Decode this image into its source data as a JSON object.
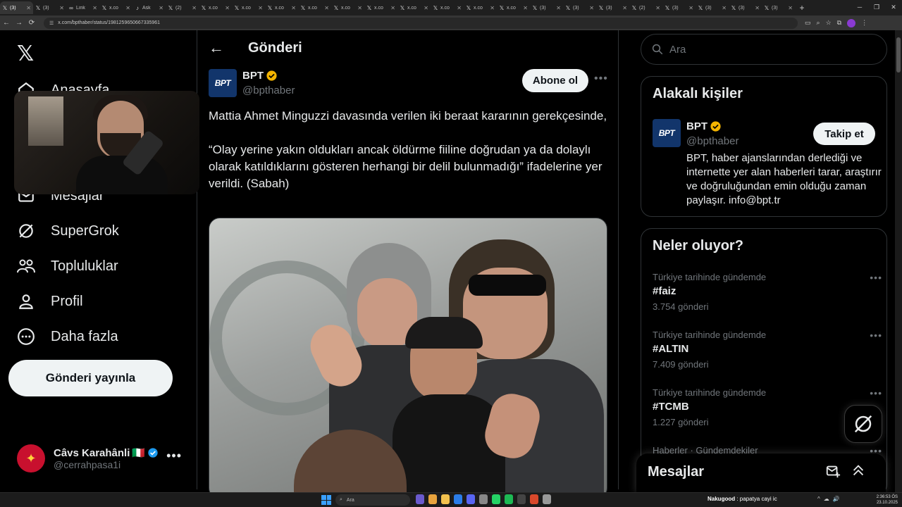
{
  "browser": {
    "tabs": [
      {
        "fav": "𝕏",
        "title": "(3)",
        "active": true
      },
      {
        "fav": "𝕏",
        "title": "(3)",
        "active": false
      },
      {
        "fav": "∞",
        "title": "Link",
        "active": false
      },
      {
        "fav": "𝕏",
        "title": "x.co",
        "active": false
      },
      {
        "fav": "♪",
        "title": "Ask",
        "active": false
      },
      {
        "fav": "𝕏",
        "title": "(2)",
        "active": false
      },
      {
        "fav": "𝕏",
        "title": "x.co",
        "active": false
      },
      {
        "fav": "𝕏",
        "title": "x.co",
        "active": false
      },
      {
        "fav": "𝕏",
        "title": "x.co",
        "active": false
      },
      {
        "fav": "𝕏",
        "title": "x.co",
        "active": false
      },
      {
        "fav": "𝕏",
        "title": "x.co",
        "active": false
      },
      {
        "fav": "𝕏",
        "title": "x.co",
        "active": false
      },
      {
        "fav": "𝕏",
        "title": "x.co",
        "active": false
      },
      {
        "fav": "𝕏",
        "title": "x.co",
        "active": false
      },
      {
        "fav": "𝕏",
        "title": "x.co",
        "active": false
      },
      {
        "fav": "𝕏",
        "title": "x.co",
        "active": false
      },
      {
        "fav": "𝕏",
        "title": "(3)",
        "active": false
      },
      {
        "fav": "𝕏",
        "title": "(3)",
        "active": false
      },
      {
        "fav": "𝕏",
        "title": "(3)",
        "active": false
      },
      {
        "fav": "𝕏",
        "title": "(2)",
        "active": false
      },
      {
        "fav": "𝕏",
        "title": "(3)",
        "active": false
      },
      {
        "fav": "𝕏",
        "title": "(3)",
        "active": false
      },
      {
        "fav": "𝕏",
        "title": "(3)",
        "active": false
      },
      {
        "fav": "𝕏",
        "title": "(3)",
        "active": false
      }
    ],
    "url": "x.com/bpthaber/status/1981259650667335961"
  },
  "sidebar": {
    "logo": "𝕏",
    "items": [
      {
        "label": "Anasayfa",
        "icon": "home-icon"
      },
      {
        "label": "Mesajlar",
        "icon": "mail-icon"
      },
      {
        "label": "SuperGrok",
        "icon": "grok-icon"
      },
      {
        "label": "Topluluklar",
        "icon": "communities-icon"
      },
      {
        "label": "Profil",
        "icon": "profile-icon"
      },
      {
        "label": "Daha fazla",
        "icon": "more-circle-icon"
      }
    ],
    "post_button": "Gönderi yayınla",
    "account": {
      "name": "Câvs Karahânli",
      "flag": "🇮🇹",
      "handle": "@cerrahpasa1i"
    }
  },
  "main": {
    "title": "Gönderi",
    "author": {
      "name": "BPT",
      "handle": "@bpthaber",
      "logo_text": "BPT"
    },
    "subscribe_label": "Abone ol",
    "text": [
      "Mattia Ahmet Minguzzi davasında verilen iki beraat kararının gerekçesinde,",
      "“Olay yerine yakın oldukları ancak öldürme fiiline doğrudan ya da dolaylı olarak katıldıklarını gösteren herhangi bir delil bulunmadığı” ifadelerine yer verildi. (Sabah)"
    ]
  },
  "right": {
    "search_placeholder": "Ara",
    "related": {
      "title": "Alakalı kişiler",
      "name": "BPT",
      "handle": "@bpthaber",
      "follow_label": "Takip et",
      "bio": "BPT, haber ajanslarından derlediği ve internette yer alan haberleri tarar, araştırır ve doğruluğundan emin olduğu zaman paylaşır. info@bpt.tr"
    },
    "trends": {
      "title": "Neler oluyor?",
      "items": [
        {
          "context": "Türkiye tarihinde gündemde",
          "name": "#faiz",
          "count": "3.754 gönderi"
        },
        {
          "context": "Türkiye tarihinde gündemde",
          "name": "#ALTIN",
          "count": "7.409 gönderi"
        },
        {
          "context": "Türkiye tarihinde gündemde",
          "name": "#TCMB",
          "count": "1.227 gönderi"
        },
        {
          "context": "Haberler · Gündemdekiler",
          "name": "",
          "count": ""
        }
      ]
    },
    "messages_dock": "Mesajlar"
  },
  "taskbar": {
    "search": "Ara",
    "now_playing_artist": "Nakugood",
    "now_playing_title": ": papatya cayi ic",
    "time": "2:36:53 ÖS",
    "date": "23.10.2025"
  },
  "colors": {
    "accent_verified": "#f4b400",
    "blue_verified": "#1d9bf0",
    "bpt_blue": "#12356b"
  }
}
